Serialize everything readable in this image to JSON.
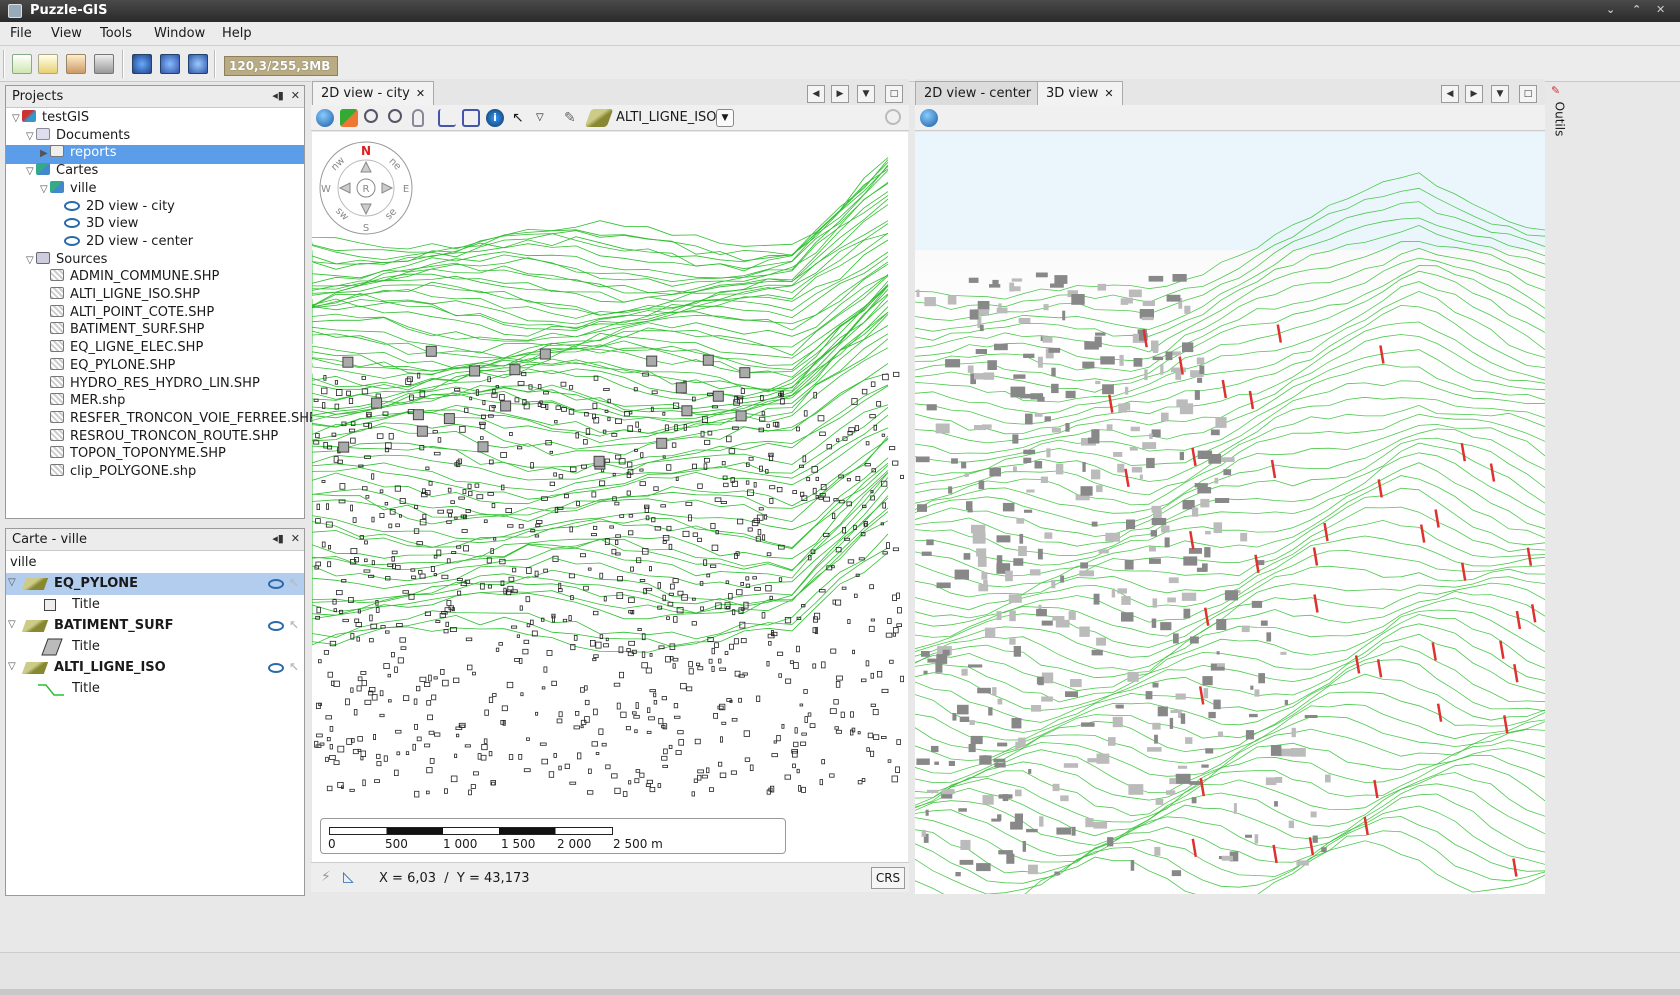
{
  "window": {
    "title": "Puzzle-GIS"
  },
  "menu": [
    {
      "label": "File",
      "key": "F"
    },
    {
      "label": "View",
      "key": "V"
    },
    {
      "label": "Tools",
      "key": "T"
    },
    {
      "label": "Window",
      "key": "W"
    },
    {
      "label": "Help",
      "key": "H"
    }
  ],
  "toolbar": {
    "memory": "120,3/255,3MB"
  },
  "projects_panel": {
    "title": "Projects",
    "tree": [
      {
        "label": "testGIS",
        "level": 0,
        "icon": "project-icon",
        "expanded": true
      },
      {
        "label": "Documents",
        "level": 1,
        "icon": "documents-icon",
        "expanded": true
      },
      {
        "label": "reports",
        "level": 2,
        "icon": "folder-icon",
        "selected": true
      },
      {
        "label": "Cartes",
        "level": 1,
        "icon": "map-context-icon",
        "expanded": true
      },
      {
        "label": "ville",
        "level": 2,
        "icon": "map-icon",
        "expanded": true
      },
      {
        "label": "2D view - city",
        "level": 3,
        "icon": "eye-icon"
      },
      {
        "label": "3D view",
        "level": 3,
        "icon": "eye-icon"
      },
      {
        "label": "2D view - center",
        "level": 3,
        "icon": "eye-icon"
      },
      {
        "label": "Sources",
        "level": 1,
        "icon": "sources-icon",
        "expanded": true
      },
      {
        "label": "ADMIN_COMMUNE.SHP",
        "level": 2,
        "icon": "shapefile-icon"
      },
      {
        "label": "ALTI_LIGNE_ISO.SHP",
        "level": 2,
        "icon": "shapefile-icon"
      },
      {
        "label": "ALTI_POINT_COTE.SHP",
        "level": 2,
        "icon": "shapefile-icon"
      },
      {
        "label": "BATIMENT_SURF.SHP",
        "level": 2,
        "icon": "shapefile-icon"
      },
      {
        "label": "EQ_LIGNE_ELEC.SHP",
        "level": 2,
        "icon": "shapefile-icon"
      },
      {
        "label": "EQ_PYLONE.SHP",
        "level": 2,
        "icon": "shapefile-icon"
      },
      {
        "label": "HYDRO_RES_HYDRO_LIN.SHP",
        "level": 2,
        "icon": "shapefile-icon"
      },
      {
        "label": "MER.shp",
        "level": 2,
        "icon": "shapefile-icon"
      },
      {
        "label": "RESFER_TRONCON_VOIE_FERREE.SHP",
        "level": 2,
        "icon": "shapefile-icon"
      },
      {
        "label": "RESROU_TRONCON_ROUTE.SHP",
        "level": 2,
        "icon": "shapefile-icon"
      },
      {
        "label": "TOPON_TOPONYME.SHP",
        "level": 2,
        "icon": "shapefile-icon"
      },
      {
        "label": "clip_POLYGONE.shp",
        "level": 2,
        "icon": "shapefile-icon"
      }
    ]
  },
  "layers_panel": {
    "title": "Carte - ville",
    "context_name": "ville",
    "layers": [
      {
        "name": "EQ_PYLONE",
        "legend": "Title",
        "legend_icon": "point-symbol-icon",
        "selected": true
      },
      {
        "name": "BATIMENT_SURF",
        "legend": "Title",
        "legend_icon": "polygon-symbol-icon",
        "selected": false
      },
      {
        "name": "ALTI_LIGNE_ISO",
        "legend": "Title",
        "legend_icon": "line-symbol-icon",
        "selected": false
      }
    ]
  },
  "left_view": {
    "tabs": [
      {
        "label": "2D view - city",
        "active": true
      }
    ],
    "active_layer": "ALTI_LIGNE_ISO",
    "compass": {
      "n": "N",
      "ne": "ne",
      "e": "E",
      "se": "se",
      "s": "S",
      "sw": "sw",
      "w": "W",
      "nw": "nw",
      "center": "R"
    },
    "scale_labels": [
      "0",
      "500",
      "1 000",
      "1 500",
      "2 000",
      "2 500 m"
    ],
    "coords": "X = 6,03  /  Y = 43,173",
    "crs_label": "CRS"
  },
  "right_view": {
    "tabs": [
      {
        "label": "2D view - center",
        "active": false
      },
      {
        "label": "3D view",
        "active": true
      }
    ],
    "side_tab": "Outils"
  },
  "colors": {
    "contour": "#2fbf2f",
    "building": "#222222",
    "pylon": "#e03030",
    "sky": "#eaf6fb"
  }
}
